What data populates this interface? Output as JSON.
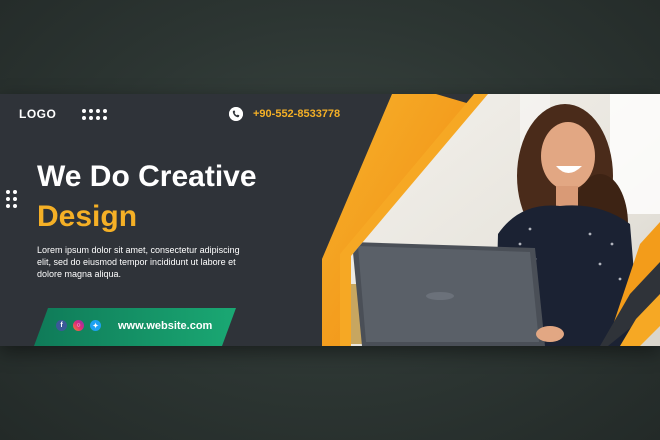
{
  "header": {
    "logo": "LOGO",
    "phone_icon": "phone-icon",
    "phone": "+90-552-8533778"
  },
  "headline": {
    "line1": "We Do Creative",
    "line2": "Design"
  },
  "body": "Lorem ipsum dolor sit amet, consectetur adipiscing elit, sed do eiusmod tempor incididunt ut labore et dolore magna aliqua.",
  "footer": {
    "social_icons": [
      "facebook-icon",
      "instagram-icon",
      "twitter-icon"
    ],
    "website": "www.website.com"
  },
  "colors": {
    "accent": "#f5b026",
    "green": "#16a06a",
    "panel": "#2f3339"
  }
}
